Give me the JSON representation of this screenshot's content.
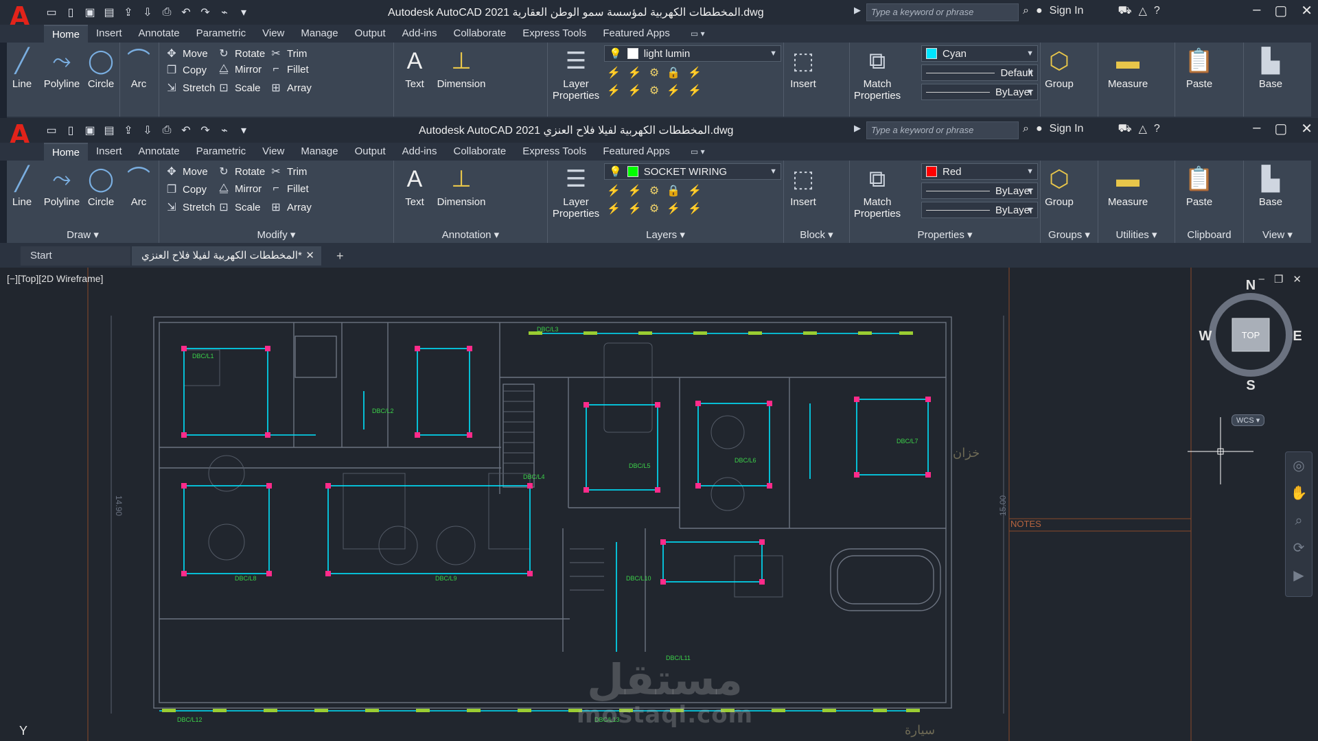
{
  "windows": [
    {
      "id": "A",
      "title": "Autodesk AutoCAD 2021   المخططات الكهربية لمؤسسة سمو الوطن العقارية.dwg",
      "layer_name": "light lumin",
      "layer_color": "#ffffff",
      "color_name": "Cyan",
      "color_swatch": "#00e5ff",
      "linetype": "Default",
      "lineweight": "ByLayer"
    },
    {
      "id": "B",
      "title": "Autodesk AutoCAD 2021   المخططات الكهربية لفيلا فلاح العنزي.dwg",
      "layer_name": "SOCKET WIRING",
      "layer_color": "#00ff00",
      "color_name": "Red",
      "color_swatch": "#ff0000",
      "linetype": "ByLayer",
      "lineweight": "ByLayer"
    }
  ],
  "search": {
    "placeholder": "Type a keyword or phrase"
  },
  "signin": "Sign In",
  "ribbon_tabs": [
    "Home",
    "Insert",
    "Annotate",
    "Parametric",
    "View",
    "Manage",
    "Output",
    "Add-ins",
    "Collaborate",
    "Express Tools",
    "Featured Apps"
  ],
  "draw": {
    "line": "Line",
    "polyline": "Polyline",
    "circle": "Circle",
    "arc": "Arc",
    "title": "Draw"
  },
  "modify": {
    "move": "Move",
    "rotate": "Rotate",
    "trim": "Trim",
    "copy": "Copy",
    "mirror": "Mirror",
    "fillet": "Fillet",
    "stretch": "Stretch",
    "scale": "Scale",
    "array": "Array",
    "title": "Modify"
  },
  "annotation": {
    "text": "Text",
    "dimension": "Dimension",
    "title": "Annotation"
  },
  "layers": {
    "props_line1": "Layer",
    "props_line2": "Properties",
    "title": "Layers"
  },
  "block": {
    "insert": "Insert",
    "title": "Block"
  },
  "properties": {
    "match1": "Match",
    "match2": "Properties",
    "title": "Properties"
  },
  "groups": {
    "group": "Group",
    "title": "Groups"
  },
  "utilities": {
    "measure": "Measure",
    "title": "Utilities"
  },
  "clipboard": {
    "paste": "Paste",
    "title": "Clipboard"
  },
  "view": {
    "base": "Base",
    "title": "View"
  },
  "doc_tabs": {
    "start": "Start",
    "file": "المخططات الكهربية لفيلا فلاح العنزي*"
  },
  "viewport": {
    "label": "[−][Top][2D Wireframe]"
  },
  "viewcube": {
    "n": "N",
    "s": "S",
    "e": "E",
    "w": "W",
    "top": "TOP",
    "wcs": "WCS"
  },
  "notes_label": "NOTES",
  "ucs_y": "Y",
  "dims": {
    "left": "14.90",
    "right": "15.00"
  },
  "arabic": {
    "store": "خزان",
    "car": "سيارة"
  },
  "watermark": {
    "arabic": "مستقل",
    "latin": "mostaql.com"
  },
  "circuit_labels": [
    "DBC/L1",
    "DBC/L2",
    "DBC/L3",
    "DBC/L4",
    "DBC/L5",
    "DBC/L6",
    "DBC/L7",
    "DBC/L8",
    "DBC/L9",
    "DBC/L10",
    "DBC/L11",
    "DBC/L12",
    "DBC/L13"
  ]
}
